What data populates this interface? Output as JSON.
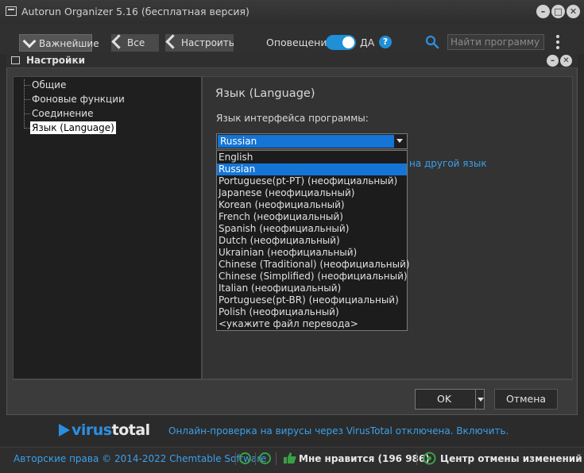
{
  "window": {
    "title": "Autorun Organizer 5.16 (бесплатная версия)",
    "controls": [
      "minimize",
      "maximize",
      "close"
    ]
  },
  "toolbar": {
    "important_label": "Важнейшие",
    "all_label": "Все",
    "settings_label": "Настроить",
    "notifications_label": "Оповещения",
    "toggle_state_label": "ДА",
    "help_icon": "?",
    "search_placeholder": "Найти программу"
  },
  "dialog": {
    "title": "Настройки",
    "tree": [
      {
        "label": "Общие"
      },
      {
        "label": "Фоновые функции"
      },
      {
        "label": "Соединение"
      },
      {
        "label": "Язык (Language)",
        "selected": true
      }
    ],
    "section_title": "Язык (Language)",
    "language_label": "Язык интерфейса программы:",
    "language_selected": "Russian",
    "language_options": [
      "English",
      "Russian",
      "Portuguese(pt-PT) (неофициальный)",
      "Japanese (неофициальный)",
      "Korean (неофициальный)",
      "French (неофициальный)",
      "Spanish (неофициальный)",
      "Dutch (неофициальный)",
      "Ukrainian (неофициальный)",
      "Chinese (Traditional) (неофициальный)",
      "Chinese (Simplified) (неофициальный)",
      "Italian (неофициальный)",
      "Portuguese(pt-BR) (неофициальный)",
      "Polish (неофициальный)",
      "<укажите файл перевода>"
    ],
    "translate_link_partial": "на другой язык",
    "ok_label": "OK",
    "cancel_label": "Отмена"
  },
  "virustotal": {
    "logo_part1": "virus",
    "logo_part2": "total",
    "status_text": "Онлайн-проверка на вирусы через VirusTotal отключена. Включить."
  },
  "statusbar": {
    "copyright": "Авторские права © 2014-2022 Chemtable Software",
    "likes_text": "Мне нравится (196 986)",
    "undo_center": "Центр отмены изменений"
  },
  "colors": {
    "accent": "#1475d6",
    "link": "#3aa0ea",
    "background": "#2b2b2b"
  }
}
